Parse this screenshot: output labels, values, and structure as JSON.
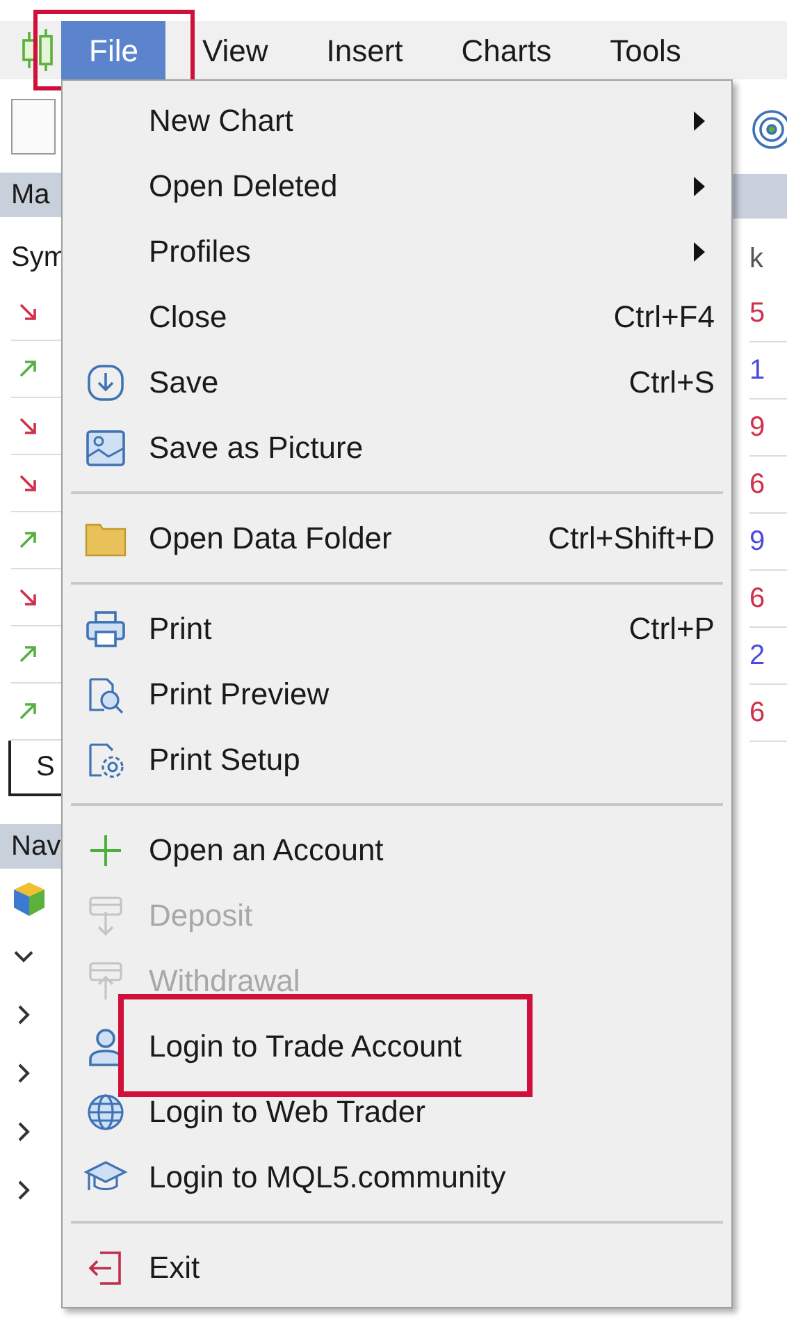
{
  "menubar": [
    {
      "label": "File",
      "selected": true,
      "framed": true
    },
    {
      "label": "View",
      "selected": false,
      "framed": false
    },
    {
      "label": "Insert",
      "selected": false,
      "framed": false
    },
    {
      "label": "Charts",
      "selected": false,
      "framed": false
    },
    {
      "label": "Tools",
      "selected": false,
      "framed": false
    }
  ],
  "market_watch": {
    "title": "Ma",
    "column_1": "Sym",
    "column_2": "k",
    "tab": "S",
    "rows": [
      {
        "kind": "down",
        "value": "5",
        "color": "#d0304a"
      },
      {
        "kind": "up",
        "value": "1",
        "color": "#4a4ae0"
      },
      {
        "kind": "down",
        "value": "9",
        "color": "#d0304a"
      },
      {
        "kind": "down",
        "value": "6",
        "color": "#d0304a"
      },
      {
        "kind": "up",
        "value": "9",
        "color": "#4a4ae0"
      },
      {
        "kind": "down",
        "value": "6",
        "color": "#d0304a"
      },
      {
        "kind": "up",
        "value": "2",
        "color": "#4a4ae0"
      },
      {
        "kind": "up",
        "value": "6",
        "color": "#d0304a"
      }
    ]
  },
  "navigator": {
    "title": "Nav",
    "nodes": [
      {
        "expanded": true
      },
      {
        "expanded": false
      },
      {
        "expanded": false
      },
      {
        "expanded": false
      },
      {
        "expanded": false
      }
    ]
  },
  "file_menu": {
    "groups": [
      [
        {
          "label": "New Chart",
          "submenu": true,
          "disabled": false,
          "framed": false
        },
        {
          "label": "Open Deleted",
          "submenu": true,
          "disabled": false,
          "framed": false
        },
        {
          "label": "Profiles",
          "submenu": true,
          "disabled": false,
          "framed": false
        },
        {
          "label": "Close",
          "shortcut": "Ctrl+F4",
          "submenu": false,
          "disabled": false,
          "framed": false
        },
        {
          "label": "Save",
          "shortcut": "Ctrl+S",
          "submenu": false,
          "disabled": false,
          "framed": false
        },
        {
          "label": "Save as Picture",
          "submenu": false,
          "disabled": false,
          "framed": false
        }
      ],
      [
        {
          "label": "Open Data Folder",
          "shortcut": "Ctrl+Shift+D",
          "submenu": false,
          "disabled": false,
          "framed": false
        }
      ],
      [
        {
          "label": "Print",
          "shortcut": "Ctrl+P",
          "submenu": false,
          "disabled": false,
          "framed": false
        },
        {
          "label": "Print Preview",
          "submenu": false,
          "disabled": false,
          "framed": false
        },
        {
          "label": "Print Setup",
          "submenu": false,
          "disabled": false,
          "framed": false
        }
      ],
      [
        {
          "label": "Open an Account",
          "submenu": false,
          "disabled": false,
          "framed": false
        },
        {
          "label": "Deposit",
          "submenu": false,
          "disabled": true,
          "framed": false
        },
        {
          "label": "Withdrawal",
          "submenu": false,
          "disabled": true,
          "framed": false
        },
        {
          "label": "Login to Trade Account",
          "submenu": false,
          "disabled": false,
          "framed": true
        },
        {
          "label": "Login to Web Trader",
          "submenu": false,
          "disabled": false,
          "framed": false
        },
        {
          "label": "Login to MQL5.community",
          "submenu": false,
          "disabled": false,
          "framed": false
        }
      ],
      [
        {
          "label": "Exit",
          "submenu": false,
          "disabled": false,
          "framed": false
        }
      ]
    ]
  }
}
